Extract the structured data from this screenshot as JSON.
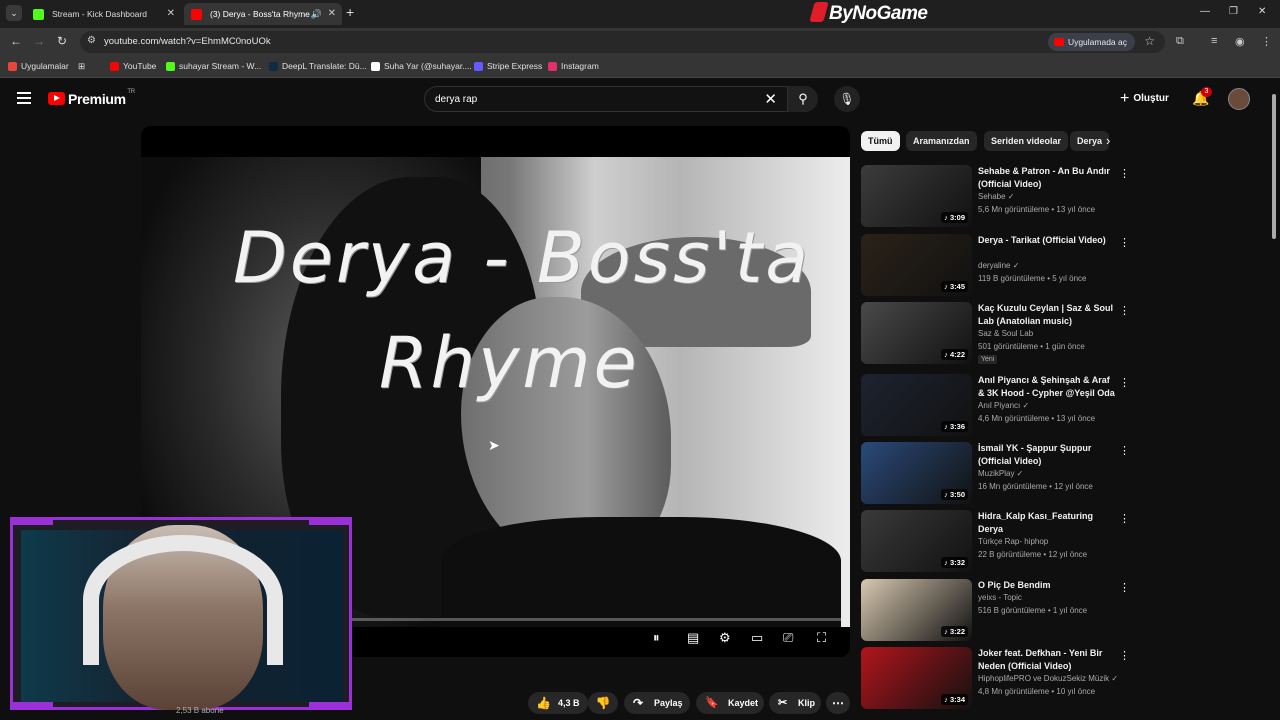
{
  "browser": {
    "tabs": [
      {
        "title": "Stream - Kick Dashboard",
        "favicon_color": "#53fc18"
      },
      {
        "title": "(3) Derya - Boss'ta Rhyme",
        "favicon_color": "#ff0000"
      }
    ],
    "brand": "ByNoGame",
    "url": "youtube.com/watch?v=EhmMC0noUOk",
    "open_in_app": "Uygulamada aç",
    "bookmarks": [
      {
        "label": "Uygulamalar",
        "color": "#e8453c"
      },
      {
        "label": "YouTube",
        "color": "#ff0000"
      },
      {
        "label": "suhayar Stream - W...",
        "color": "#53fc18"
      },
      {
        "label": "DeepL Translate: Dü...",
        "color": "#0f2b46"
      },
      {
        "label": "Suha Yar (@suhayar....",
        "color": "#ffffff"
      },
      {
        "label": "Stripe Express",
        "color": "#635bff"
      },
      {
        "label": "Instagram",
        "color": "#e1306c"
      }
    ]
  },
  "youtube": {
    "logo": "Premium",
    "region": "TR",
    "search_query": "derya rap",
    "create_label": "Oluştur",
    "notifications": "3"
  },
  "video": {
    "overlay_line1": "Derya - Boss'ta",
    "overlay_line2": "Rhyme",
    "likes": "4,3 B",
    "share": "Paylaş",
    "save": "Kaydet",
    "clip": "Klip",
    "subscribers": "2,53 B abone"
  },
  "chips": [
    "Tümü",
    "Aramanızdan",
    "Seriden videolar",
    "Derya"
  ],
  "recommendations": [
    {
      "title": "Sehabe & Patron - An Bu Andır (Official Video)",
      "channel": "Sehabe",
      "verified": true,
      "meta": "5,6 Mn görüntüleme • 13 yıl önce",
      "duration": "3:09",
      "thumb": "#3c3c3c"
    },
    {
      "title": "Derya - Tarikat (Official Video)",
      "channel": "deryaline",
      "verified": true,
      "meta": "119 B görüntüleme • 5 yıl önce",
      "duration": "3:45",
      "thumb": "#2a2218"
    },
    {
      "title": "Kaç Kuzulu Ceylan | Saz & Soul Lab (Anatolian music)",
      "channel": "Saz & Soul Lab",
      "verified": false,
      "meta": "501 görüntüleme • 1 gün önce",
      "badge": "Yeni",
      "duration": "4:22",
      "thumb": "#4a4a4a"
    },
    {
      "title": "Anıl Piyancı & Şehinşah & Araf & 3K Hood - Cypher @Yeşil Oda",
      "channel": "Anıl Piyancı",
      "verified": true,
      "meta": "4,6 Mn görüntüleme • 13 yıl önce",
      "duration": "3:36",
      "thumb": "#1e2330"
    },
    {
      "title": "İsmail YK - Şappur Şuppur (Official Video)",
      "channel": "MuzikPlay",
      "verified": true,
      "meta": "16 Mn görüntüleme • 12 yıl önce",
      "duration": "3:50",
      "thumb": "#2a4a7a"
    },
    {
      "title": "Hidra_Kalp Kası_Featuring Derya",
      "channel": "Türkçe Rap- hiphop",
      "verified": false,
      "meta": "22 B görüntüleme • 12 yıl önce",
      "duration": "3:32",
      "thumb": "#3a3a3a"
    },
    {
      "title": "O Piç De Bendim",
      "channel": "yeixs - Topic",
      "verified": false,
      "meta": "516 B görüntüleme • 1 yıl önce",
      "duration": "3:22",
      "thumb": "#d8c8b0"
    },
    {
      "title": "Joker feat. Defkhan - Yeni Bir Neden (Official Video)",
      "channel": "HiphoplifePRO ve DokuzSekiz Müzik",
      "verified": true,
      "meta": "4,8 Mn görüntüleme • 10 yıl önce",
      "duration": "3:34",
      "thumb": "#b3141c"
    }
  ]
}
